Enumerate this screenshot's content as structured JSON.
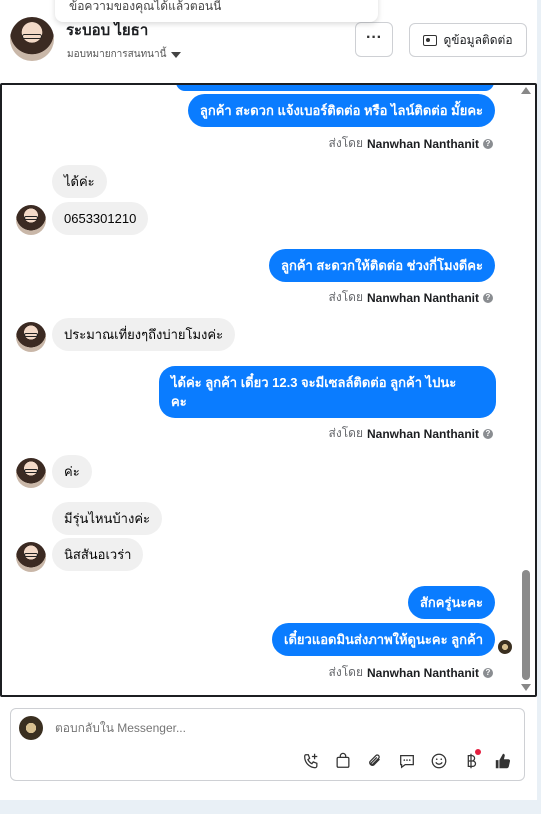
{
  "toast": {
    "text": "ข้อความของคุณได้แล้วตอนนี้"
  },
  "header": {
    "name": "ระบอบ ไยธา",
    "assign_label": "มอบหมายการสนทนานี้",
    "more_label": "···",
    "contact_button": "ดูข้อมูลติดต่อ"
  },
  "messages": [
    {
      "dir": "out",
      "text": "ลูกค้า สะดวก แจ้งเบอร์ติดต่อ หรือ ไลน์ติดต่อ มั้ยคะ"
    },
    {
      "sent_prefix": "ส่งโดย",
      "sent_name": "Nanwhan Nanthanit"
    },
    {
      "dir": "in",
      "text": "ได้ค่ะ"
    },
    {
      "dir": "in",
      "text": "0653301210"
    },
    {
      "dir": "out",
      "text": "ลูกค้า สะดวกให้ติดต่อ ช่วงกี่โมงดีคะ"
    },
    {
      "sent_prefix": "ส่งโดย",
      "sent_name": "Nanwhan Nanthanit"
    },
    {
      "dir": "in",
      "text": "ประมาณเที่ยงๆถึงบ่ายโมงค่ะ"
    },
    {
      "dir": "out",
      "line1": "ได้ค่ะ  ลูกค้า เดี๋ยว 12.3 จะมีเซลล์ติดต่อ ลูกค้า ไปนะ",
      "line2": "คะ"
    },
    {
      "sent_prefix": "ส่งโดย",
      "sent_name": "Nanwhan Nanthanit"
    },
    {
      "dir": "in",
      "text": "ค่ะ"
    },
    {
      "dir": "in",
      "text": "มีรุ่นไหนบ้างค่ะ"
    },
    {
      "dir": "in",
      "text": "นิสสันอเวร่า"
    },
    {
      "dir": "out",
      "text": "สักครู่นะคะ"
    },
    {
      "dir": "out",
      "text": "เดี๋ยวแอดมินส่งภาพให้ดูนะคะ  ลูกค้า"
    },
    {
      "sent_prefix": "ส่งโดย",
      "sent_name": "Nanwhan Nanthanit"
    }
  ],
  "composer": {
    "placeholder": "ตอบกลับใน Messenger...",
    "tools": [
      "phone-add-icon",
      "bag-icon",
      "paperclip-icon",
      "chat-icon",
      "emoji-icon",
      "baht-icon",
      "thumbs-up-icon"
    ]
  },
  "colors": {
    "accent": "#0a7cff",
    "incoming": "#f0f0f0",
    "badge": "#e41e3f"
  }
}
